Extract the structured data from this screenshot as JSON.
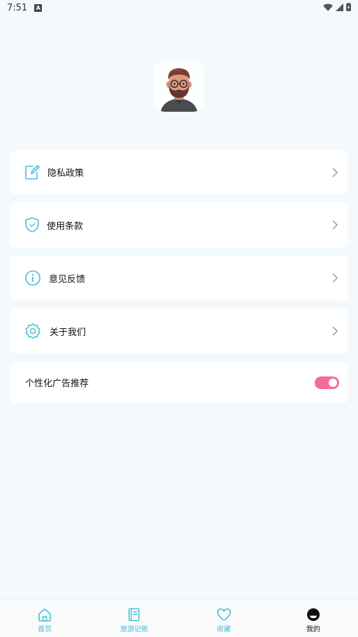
{
  "status": {
    "time": "7:51"
  },
  "menu": [
    {
      "label": "隐私政策",
      "icon": "edit-note-icon"
    },
    {
      "label": "使用条款",
      "icon": "shield-check-icon"
    },
    {
      "label": "意见反馈",
      "icon": "info-icon"
    },
    {
      "label": "关于我们",
      "icon": "gear-icon"
    }
  ],
  "ad_setting": {
    "label": "个性化广告推荐",
    "enabled": true
  },
  "tabs": [
    {
      "label": "首页",
      "icon": "home-icon"
    },
    {
      "label": "旅游记账",
      "icon": "notebook-icon"
    },
    {
      "label": "收藏",
      "icon": "heart-icon"
    },
    {
      "label": "我的",
      "icon": "profile-icon"
    }
  ],
  "colors": {
    "accent": "#45bfd8",
    "toggle_on": "#f36b9a",
    "background": "#f3f9fc"
  }
}
